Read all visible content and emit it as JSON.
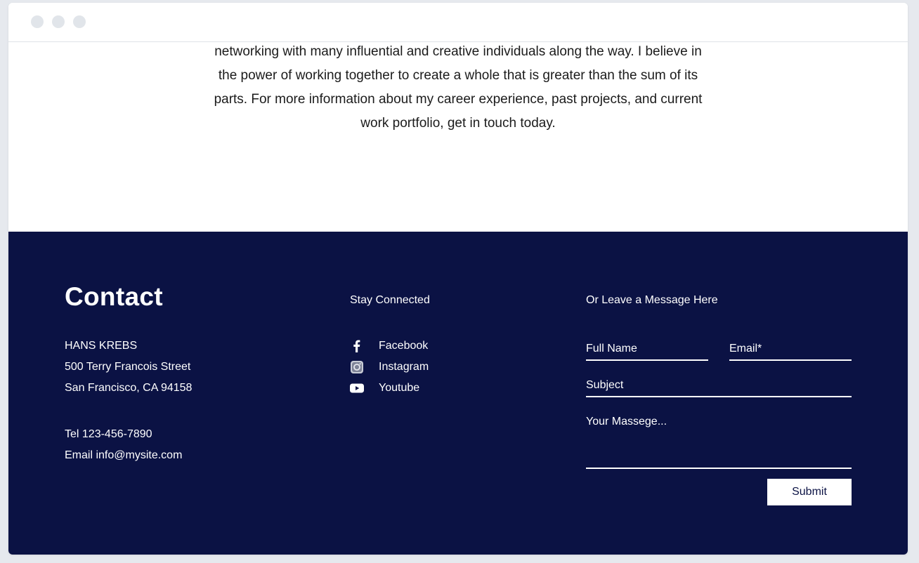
{
  "about": {
    "lines": [
      "networking with many influential and creative individuals along the way. I believe in",
      "the power of working together to create a whole that is greater than the sum of its",
      "parts. For more information about my career experience, past projects, and current",
      "work portfolio, get in touch today."
    ]
  },
  "contact": {
    "title": "Contact",
    "name": "HANS KREBS",
    "street": "500 Terry Francois Street",
    "city": "San Francisco, CA 94158",
    "tel": "Tel 123-456-7890",
    "email": "Email info@mysite.com"
  },
  "social": {
    "heading": "Stay Connected",
    "items": [
      {
        "label": "Facebook",
        "icon": "facebook-icon"
      },
      {
        "label": "Instagram",
        "icon": "instagram-icon"
      },
      {
        "label": "Youtube",
        "icon": "youtube-icon"
      }
    ]
  },
  "form": {
    "heading": "Or Leave a Message Here",
    "full_name_placeholder": "Full Name",
    "email_placeholder": "Email*",
    "subject_placeholder": "Subject",
    "message_placeholder": "Your Massege...",
    "submit_label": "Submit"
  },
  "colors": {
    "footer_bg": "#0b1244",
    "text_dark": "#1b1b1b",
    "window_dots": "#e1e5ea"
  }
}
